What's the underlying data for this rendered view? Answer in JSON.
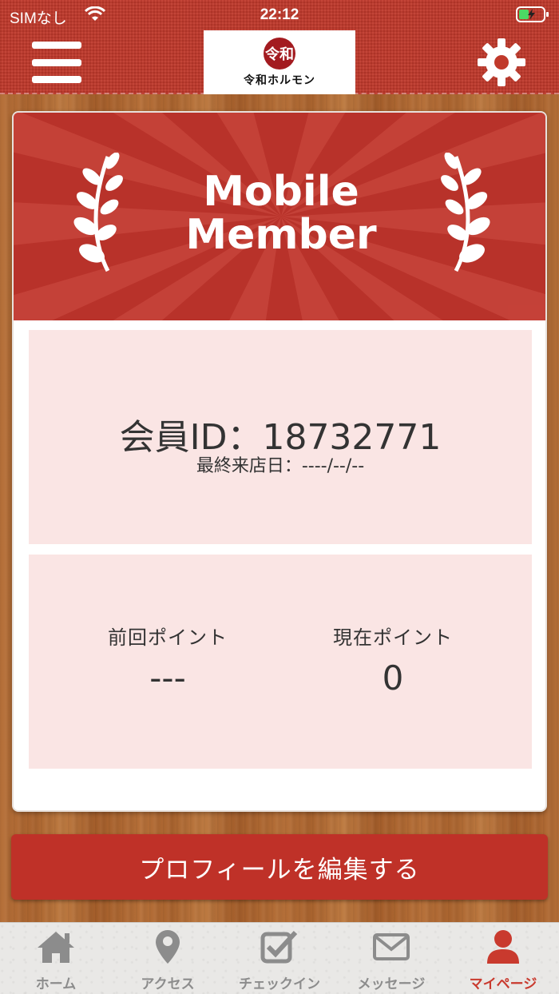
{
  "status_bar": {
    "carrier": "SIMなし",
    "time": "22:12"
  },
  "header": {
    "logo_mark": "令和",
    "logo_text": "令和ホルモン"
  },
  "banner": {
    "title": "Mobile\nMember"
  },
  "member": {
    "id_text": "会員ID：18732771",
    "last_visit_text": "最終来店日：----/--/--"
  },
  "points": {
    "previous_label": "前回ポイント",
    "previous_value": "---",
    "current_label": "現在ポイント",
    "current_value": "0"
  },
  "edit_button_label": "プロフィールを編集する",
  "tabs": [
    {
      "label": "ホーム",
      "icon": "home-icon",
      "active": false
    },
    {
      "label": "アクセス",
      "icon": "map-pin-icon",
      "active": false
    },
    {
      "label": "チェックイン",
      "icon": "checkbox-icon",
      "active": false
    },
    {
      "label": "メッセージ",
      "icon": "envelope-icon",
      "active": false
    },
    {
      "label": "マイページ",
      "icon": "user-icon",
      "active": true
    }
  ],
  "colors": {
    "brand_red": "#c0392b",
    "panel_pink": "#fae5e4",
    "active_tab": "#c93a2e",
    "inactive_tab": "#8c8c8c"
  }
}
